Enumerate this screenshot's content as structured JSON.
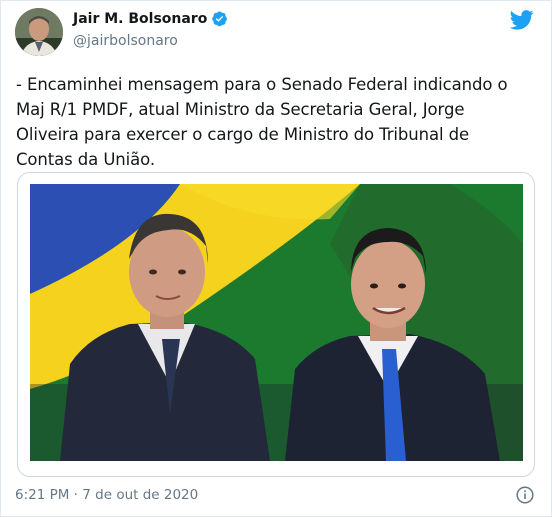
{
  "author": {
    "display_name": "Jair M. Bolsonaro",
    "handle": "@jairbolsonaro",
    "verified": true,
    "avatar_icon": "user-avatar-photo"
  },
  "tweet": {
    "text": "- Encaminhei mensagem para o Senado Federal indicando o\nMaj R/1 PMDF, atual Ministro da Secretaria Geral, Jorge\nOliveira para exercer o cargo de Ministro do Tribunal de\nContas da União.",
    "timestamp": "6:21 PM · 7 de out de 2020"
  },
  "media": {
    "kind": "photo"
  },
  "icons": {
    "brand": "twitter-bird-icon",
    "verified": "verified-badge-icon",
    "info": "info-icon"
  },
  "colors": {
    "twitter_blue": "#1da1f2",
    "text_primary": "#14171a",
    "text_secondary": "#657786",
    "border": "#ccd6dd"
  }
}
